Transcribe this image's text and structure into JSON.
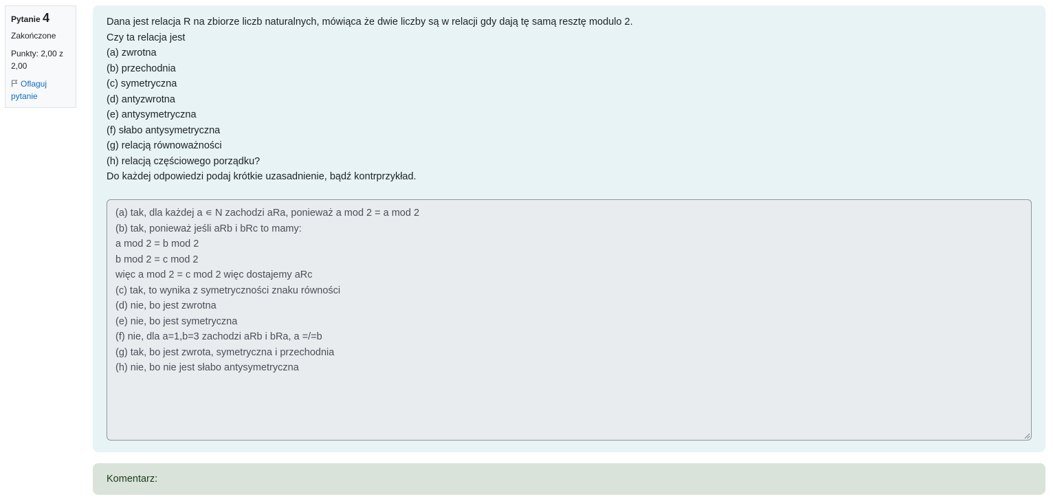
{
  "info": {
    "question_label": "Pytanie",
    "question_number": "4",
    "state": "Zakończone",
    "grade": "Punkty: 2,00 z 2,00",
    "flag_label": "Oflaguj pytanie",
    "flag_icon": "flag-icon"
  },
  "question": {
    "lines": [
      "Dana jest relacja R na zbiorze liczb naturalnych, mówiąca że dwie liczby są w relacji gdy dają tę samą resztę modulo 2.",
      "Czy ta relacja jest",
      "(a) zwrotna",
      "(b) przechodnia",
      "(c) symetryczna",
      "(d) antyzwrotna",
      "(e) antysymetryczna",
      "(f) słabo antysymetryczna",
      "(g) relacją równoważności",
      "(h) relacją częściowego porządku?",
      "Do każdej odpowiedzi podaj krótkie uzasadnienie, bądź kontrprzykład."
    ]
  },
  "answer": {
    "lines": [
      "(a) tak, dla każdej a ∊ N zachodzi aRa, ponieważ a mod 2 = a mod 2",
      "(b) tak, ponieważ jeśli aRb i bRc to mamy:",
      "a mod 2 = b mod 2",
      "b mod 2 = c mod 2",
      "więc a mod 2 = c mod 2 więc dostajemy aRc",
      "(c) tak, to wynika z symetryczności znaku równości",
      "(d) nie, bo jest zwrotna",
      "(e) nie, bo jest symetryczna",
      "(f) nie, dla a=1,b=3 zachodzi aRb i bRa, a =/=b",
      "(g) tak, bo jest zwrota, symetryczna i przechodnia",
      "(h) nie, bo nie jest słabo antysymetryczna"
    ]
  },
  "comment": {
    "label": "Komentarz:"
  },
  "colors": {
    "info_bg": "#f8f9fa",
    "formulation_bg": "#e7f3f5",
    "answer_bg": "#e9ecef",
    "comment_bg": "#d9e3d9",
    "link": "#0f6cbf"
  }
}
